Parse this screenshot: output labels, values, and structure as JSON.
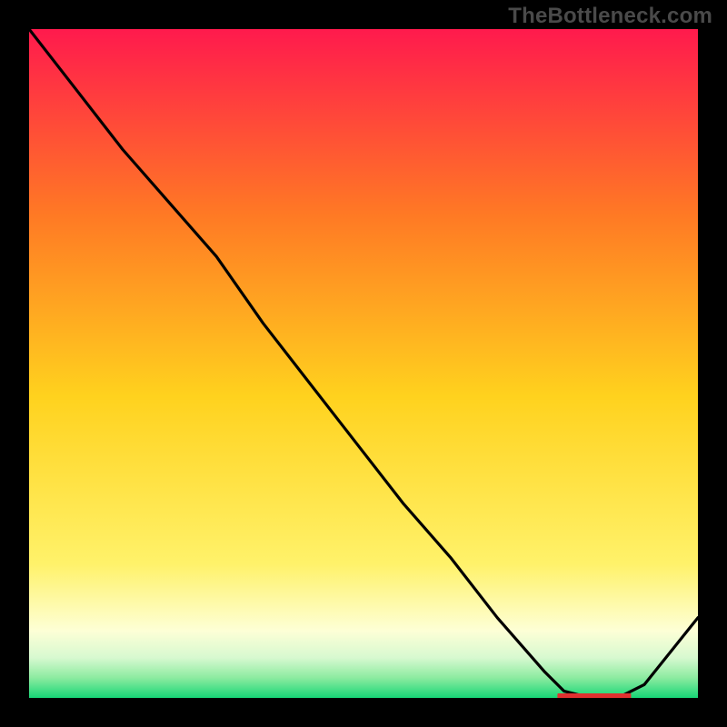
{
  "watermark": "TheBottleneck.com",
  "colors": {
    "gradient_top": "#ff1a4d",
    "gradient_upper": "#ff7a24",
    "gradient_mid": "#ffd21e",
    "gradient_lower": "#fff8b8",
    "gradient_band": "#c5f7c8",
    "gradient_bottom": "#17d676",
    "line": "#000000",
    "background": "#000000",
    "bar_text": "#e03030"
  },
  "bar_label": "",
  "chart_data": {
    "type": "line",
    "title": "",
    "xlabel": "",
    "ylabel": "",
    "xlim": [
      0,
      100
    ],
    "ylim": [
      0,
      100
    ],
    "x": [
      0,
      7,
      14,
      21,
      28,
      35,
      42,
      49,
      56,
      63,
      70,
      77,
      80,
      84,
      88,
      92,
      100
    ],
    "values": [
      100,
      91,
      82,
      74,
      66,
      56,
      47,
      38,
      29,
      21,
      12,
      4,
      1,
      0,
      0,
      2,
      12
    ],
    "bar_region": {
      "x_start": 79,
      "x_end": 90,
      "y": 0
    },
    "gradient_stops": [
      {
        "pct": 0,
        "color": "#ff1a4d"
      },
      {
        "pct": 28,
        "color": "#ff7a24"
      },
      {
        "pct": 55,
        "color": "#ffd21e"
      },
      {
        "pct": 80,
        "color": "#fff26a"
      },
      {
        "pct": 90,
        "color": "#fdffd6"
      },
      {
        "pct": 94,
        "color": "#d7f9d0"
      },
      {
        "pct": 97,
        "color": "#8ceba0"
      },
      {
        "pct": 100,
        "color": "#17d676"
      }
    ]
  }
}
